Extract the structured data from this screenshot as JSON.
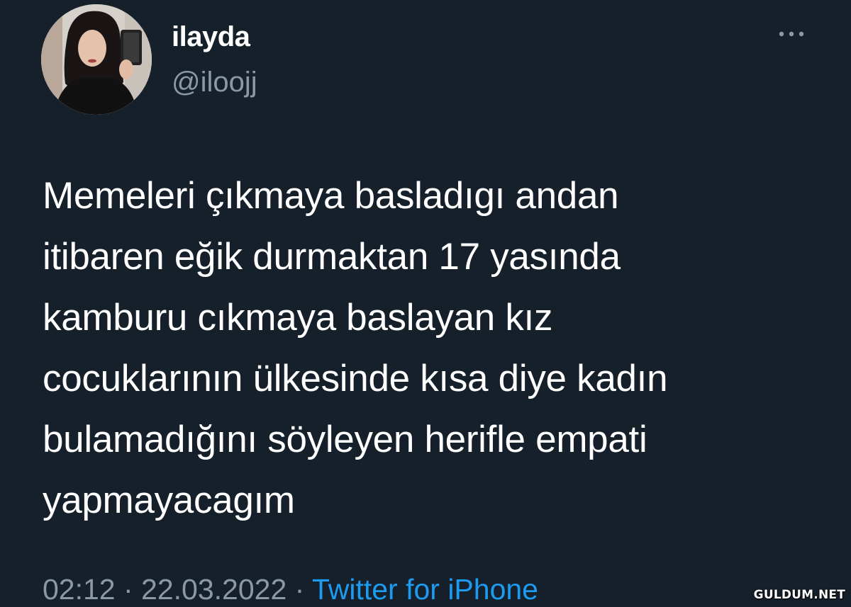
{
  "user": {
    "display_name": "ilayda",
    "handle": "@iloojj"
  },
  "tweet": {
    "lines": [
      "Memeleri çıkmaya basladıgı andan",
      "itibaren eğik durmaktan 17 yasında",
      "kamburu cıkmaya baslayan kız",
      "cocuklarının ülkesinde kısa diye kadın",
      "bulamadığını söyleyen herifle empati",
      "yapmayacagım"
    ]
  },
  "meta": {
    "time": "02:12",
    "separator": " · ",
    "date": "22.03.2022",
    "source": "Twitter for iPhone"
  },
  "icons": {
    "more": "more-options-icon"
  },
  "colors": {
    "background": "#15202b",
    "secondary_text": "#8b98a5",
    "link": "#1d9bf0"
  },
  "watermark": "GULDUM.NET"
}
